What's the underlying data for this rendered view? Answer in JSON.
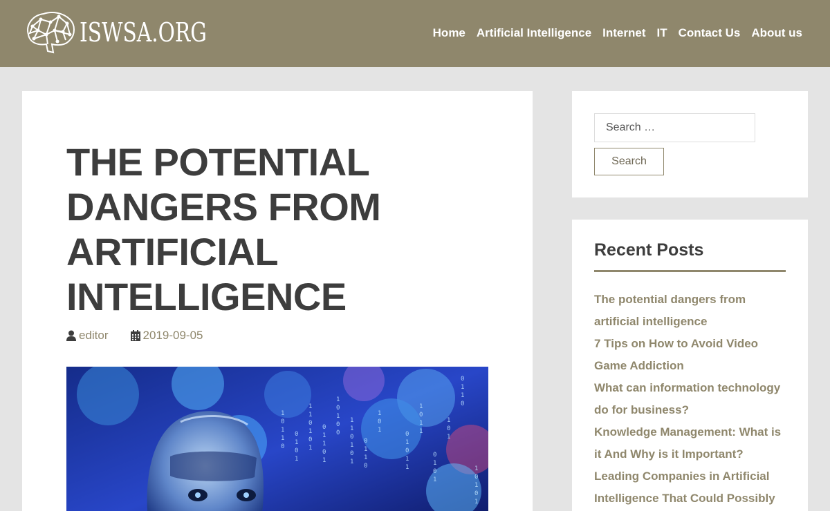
{
  "site": {
    "logo_text": "ISWSA.ORG"
  },
  "nav": [
    {
      "label": "Home"
    },
    {
      "label": "Artificial Intelligence"
    },
    {
      "label": "Internet"
    },
    {
      "label": "IT"
    },
    {
      "label": "Contact Us"
    },
    {
      "label": "About us"
    }
  ],
  "article": {
    "title": "THE POTENTIAL DANGERS FROM ARTIFICIAL INTELLIGENCE",
    "author": "editor",
    "date": "2019-09-05",
    "author_icon": "user-icon",
    "date_icon": "calendar-icon"
  },
  "search": {
    "placeholder": "Search …",
    "button_label": "Search"
  },
  "recent_posts": {
    "title": "Recent Posts",
    "items": [
      "The potential dangers from artificial intelligence",
      "7 Tips on How to Avoid Video Game Addiction",
      "What can information technology do for business?",
      "Knowledge Management: What is it And Why is it Important?",
      "Leading Companies in Artificial Intelligence That Could Possibly"
    ]
  },
  "colors": {
    "header": "#8f876c",
    "accent": "#8f876c",
    "title": "#3d3d3d",
    "background": "#e4e4e4"
  }
}
